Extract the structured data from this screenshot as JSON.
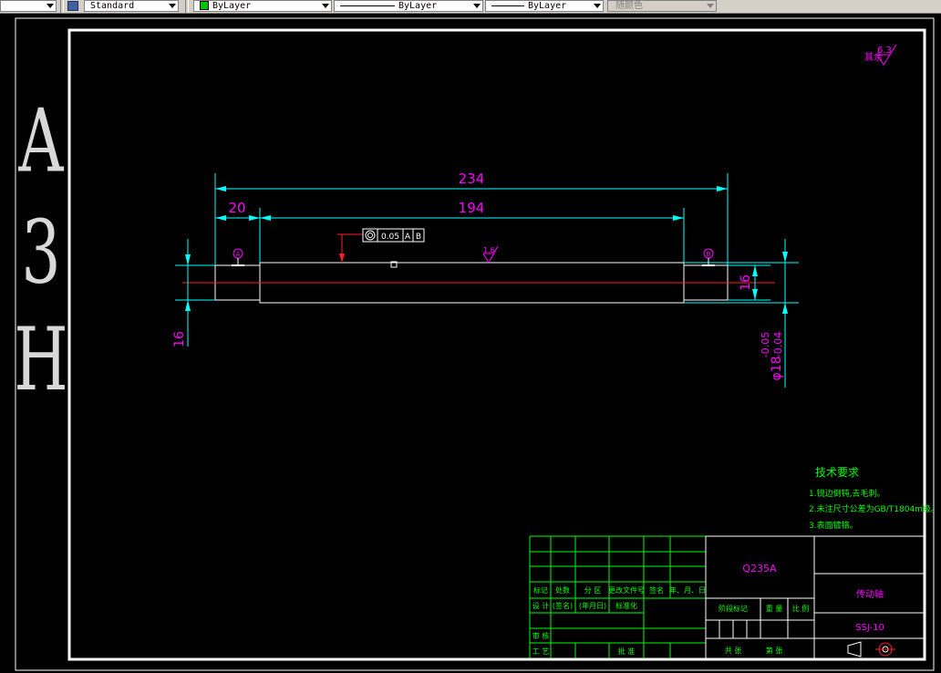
{
  "toolbar": {
    "text_style": "Standard",
    "layer": "ByLayer",
    "linetype": "ByLayer",
    "lineweight": "ByLayer",
    "plot_style": "随颜色"
  },
  "sheet": {
    "format_label_1": "A",
    "format_label_2": "3",
    "format_label_3": "H"
  },
  "roughness": {
    "prefix": "其余",
    "value": "6.3",
    "mark_value": "1.6"
  },
  "dimensions": {
    "overall_length": "234",
    "middle_length": "194",
    "end_length": "20",
    "left_dia": "16",
    "right_dia": "16",
    "main_dia": "φ18",
    "tol_upper": "-0.05",
    "tol_lower": "-0.04"
  },
  "tolerance_frame": {
    "value": "0.05",
    "datum_a": "A",
    "datum_b": "B"
  },
  "datums": {
    "left": "A",
    "right": "B"
  },
  "tech_requirements": {
    "title": "技术要求",
    "item1": "1.锐边倒钝,去毛刺。",
    "item2": "2.未注尺寸公差为GB/T1804m级。",
    "item3": "3.表面镀铬。"
  },
  "title_block": {
    "material": "Q235A",
    "part_name": "传动轴",
    "drawing_no": "SSJ-10",
    "h_mark": "标记",
    "h_count": "处数",
    "h_zone": "分 区",
    "h_docno": "更改文件号",
    "h_sign": "签名",
    "h_date": "年、月、日",
    "r_design": "设 计",
    "r_sign": "(签名)",
    "r_date": "(年月日)",
    "r_std": "标准化",
    "r_review": "审 核",
    "r_process": "工 艺",
    "r_approve": "批 准",
    "stage_mark": "阶段标记",
    "weight": "重 量",
    "scale": "比 例",
    "total": "共   张",
    "sheet_no": "第   张"
  },
  "colors": {
    "background": "#000000",
    "border": "#ffffff",
    "dimension": "#00ffff",
    "dimension_text": "#ff00ff",
    "centerline": "#ff0000",
    "table_lines": "#00ff00",
    "tech_text": "#00ff00",
    "title_text": "#ff00ff"
  }
}
